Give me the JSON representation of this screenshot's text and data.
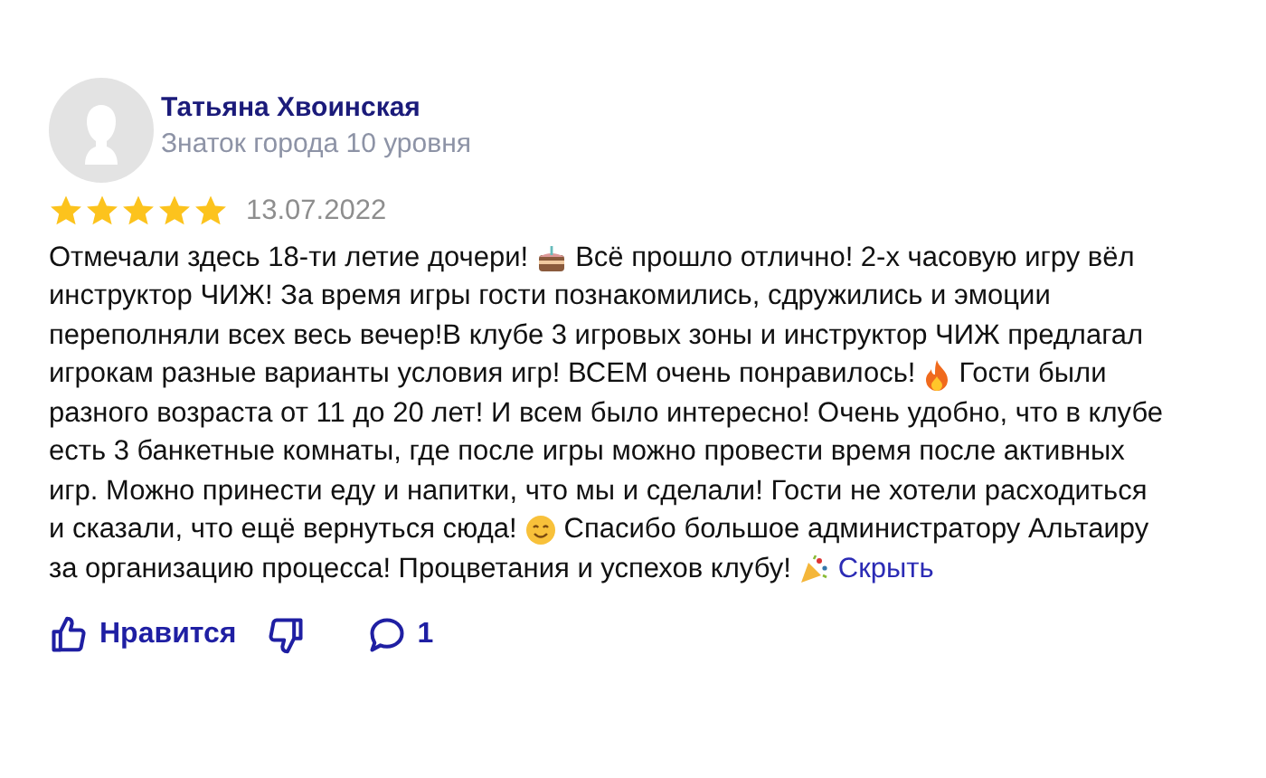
{
  "author": {
    "name": "Татьяна Хвоинская",
    "level": "Знаток города 10 уровня"
  },
  "rating": {
    "stars": 5,
    "date": "13.07.2022"
  },
  "review": {
    "lines": [
      [
        {
          "kind": "text",
          "text": "Отмечали здесь 18-ти летие дочери!"
        },
        {
          "kind": "cake"
        },
        {
          "kind": "text",
          "text": "Всё прошло отлично! 2-х часовую игру вёл"
        }
      ],
      [
        {
          "kind": "text",
          "text": "инструктор ЧИЖ! За время игры гости познакомились, сдружились и эмоции"
        }
      ],
      [
        {
          "kind": "text",
          "text": "переполняли всех весь вечер!В клубе 3 игровых зоны и инструктор ЧИЖ предлагал"
        }
      ],
      [
        {
          "kind": "text",
          "text": "игрокам разные варианты условия игр! ВСЕМ очень понравилось!"
        },
        {
          "kind": "fire"
        },
        {
          "kind": "text",
          "text": "Гости были"
        }
      ],
      [
        {
          "kind": "text",
          "text": "разного возраста от 11 до 20 лет! И всем было интересно! Очень удобно, что в клубе"
        }
      ],
      [
        {
          "kind": "text",
          "text": "есть 3 банкетные комнаты, где после игры можно провести время после активных"
        }
      ],
      [
        {
          "kind": "text",
          "text": "игр. Можно принести еду и напитки, что мы и сделали! Гости не хотели расходиться"
        }
      ],
      [
        {
          "kind": "text",
          "text": "и сказали, что ещё вернуться сюда!"
        },
        {
          "kind": "smile"
        },
        {
          "kind": "text",
          "text": "Спасибо большое администратору Альтаиру"
        }
      ],
      [
        {
          "kind": "text",
          "text": "за организацию процесса! Процветания и успехов клубу!"
        },
        {
          "kind": "party"
        },
        {
          "kind": "link",
          "text": "Скрыть"
        }
      ]
    ]
  },
  "actions": {
    "like_label": "Нравится",
    "comments_count": "1"
  }
}
